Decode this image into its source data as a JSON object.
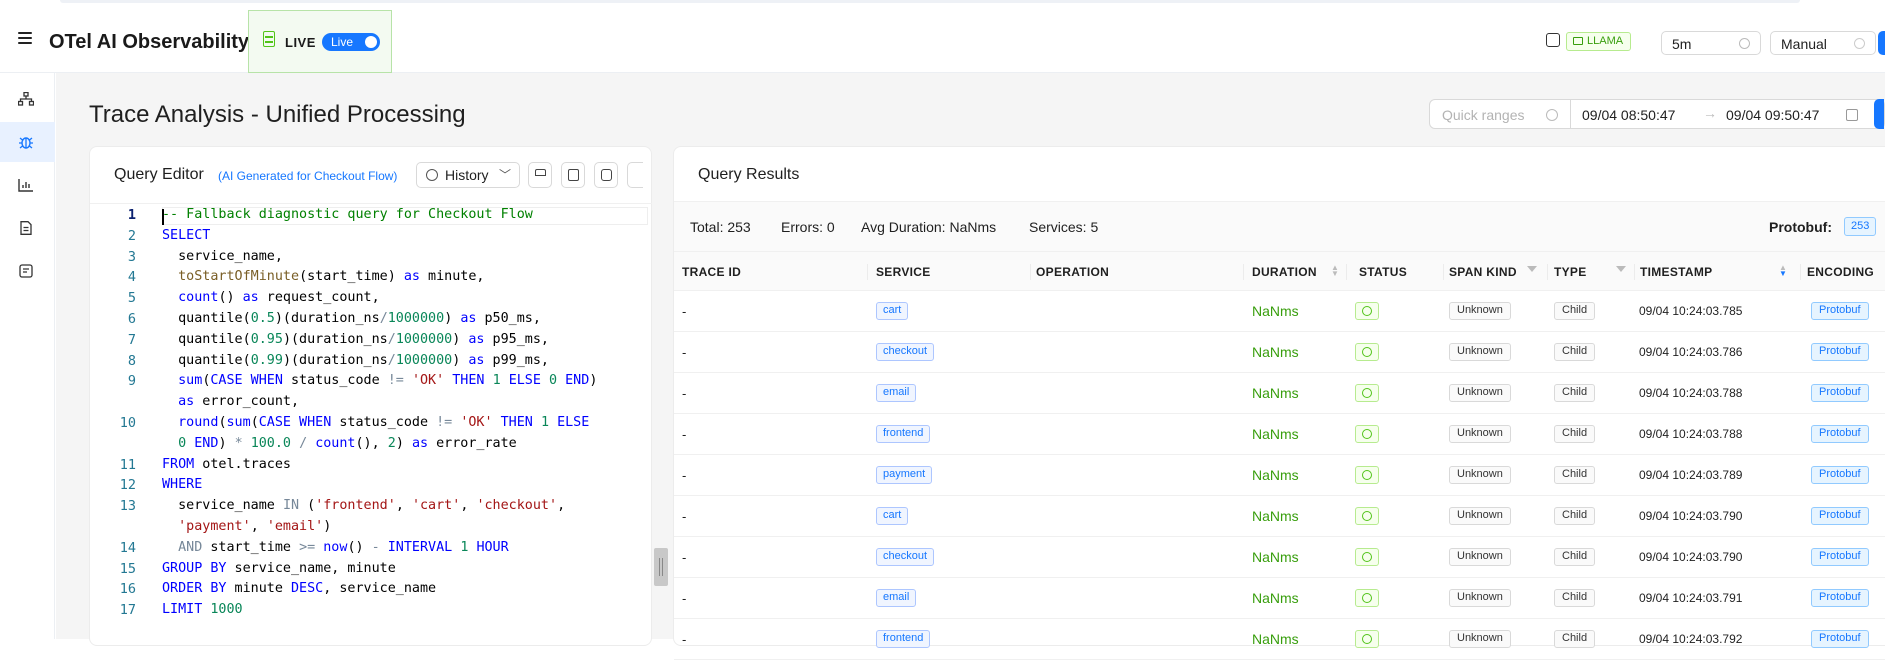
{
  "header": {
    "app_title": "OTel AI Observability",
    "live_label": "LIVE",
    "live_toggle": "Live",
    "llm_tag": "LLAMA",
    "interval": "5m",
    "refresh_mode": "Manual"
  },
  "sidebar": {
    "items": [
      {
        "icon": "topology-icon"
      },
      {
        "icon": "bug-icon",
        "active": true
      },
      {
        "icon": "bar-chart-icon"
      },
      {
        "icon": "document-icon"
      },
      {
        "icon": "llm-icon"
      }
    ]
  },
  "page": {
    "title": "Trace Analysis - Unified Processing",
    "quick_ranges_placeholder": "Quick ranges",
    "time_from": "09/04 08:50:47",
    "time_arrow": "→",
    "time_to": "09/04 09:50:47"
  },
  "editor": {
    "title": "Query Editor",
    "subtitle": "(AI Generated for Checkout Flow)",
    "history_label": "History",
    "line_numbers": [
      "1",
      "2",
      "3",
      "4",
      "5",
      "6",
      "7",
      "8",
      "9",
      "",
      "10",
      "",
      "11",
      "12",
      "13",
      "",
      "14",
      "15",
      "16",
      "17"
    ]
  },
  "results": {
    "title": "Query Results",
    "stats": {
      "total_label": "Total:",
      "total": "253",
      "errors_label": "Errors:",
      "errors": "0",
      "avg_label": "Avg Duration:",
      "avg": "NaNms",
      "services_label": "Services:",
      "services": "5",
      "protobuf_label": "Protobuf:",
      "protobuf_count": "253"
    },
    "columns": [
      "TRACE ID",
      "SERVICE",
      "OPERATION",
      "DURATION",
      "STATUS",
      "SPAN KIND",
      "TYPE",
      "TIMESTAMP",
      "ENCODING"
    ],
    "rows": [
      {
        "trace_id": "-",
        "service": "cart",
        "duration": "NaNms",
        "span_kind": "Unknown",
        "type": "Child",
        "timestamp": "09/04 10:24:03.785",
        "encoding": "Protobuf"
      },
      {
        "trace_id": "-",
        "service": "checkout",
        "duration": "NaNms",
        "span_kind": "Unknown",
        "type": "Child",
        "timestamp": "09/04 10:24:03.786",
        "encoding": "Protobuf"
      },
      {
        "trace_id": "-",
        "service": "email",
        "duration": "NaNms",
        "span_kind": "Unknown",
        "type": "Child",
        "timestamp": "09/04 10:24:03.788",
        "encoding": "Protobuf"
      },
      {
        "trace_id": "-",
        "service": "frontend",
        "duration": "NaNms",
        "span_kind": "Unknown",
        "type": "Child",
        "timestamp": "09/04 10:24:03.788",
        "encoding": "Protobuf"
      },
      {
        "trace_id": "-",
        "service": "payment",
        "duration": "NaNms",
        "span_kind": "Unknown",
        "type": "Child",
        "timestamp": "09/04 10:24:03.789",
        "encoding": "Protobuf"
      },
      {
        "trace_id": "-",
        "service": "cart",
        "duration": "NaNms",
        "span_kind": "Unknown",
        "type": "Child",
        "timestamp": "09/04 10:24:03.790",
        "encoding": "Protobuf"
      },
      {
        "trace_id": "-",
        "service": "checkout",
        "duration": "NaNms",
        "span_kind": "Unknown",
        "type": "Child",
        "timestamp": "09/04 10:24:03.790",
        "encoding": "Protobuf"
      },
      {
        "trace_id": "-",
        "service": "email",
        "duration": "NaNms",
        "span_kind": "Unknown",
        "type": "Child",
        "timestamp": "09/04 10:24:03.791",
        "encoding": "Protobuf"
      },
      {
        "trace_id": "-",
        "service": "frontend",
        "duration": "NaNms",
        "span_kind": "Unknown",
        "type": "Child",
        "timestamp": "09/04 10:24:03.792",
        "encoding": "Protobuf"
      }
    ]
  },
  "code": {
    "l1": "-- Fallback diagnostic query for Checkout Flow",
    "l2": "SELECT",
    "l3a": "  service_name,",
    "l4a": "  toStartOfMinute",
    "l4b": "(start_time) ",
    "l4c": "as",
    "l4d": " minute,",
    "l5a": "  count",
    "l5b": "() ",
    "l5c": "as",
    "l5d": " request_count,",
    "l6a": "  quantile(",
    "l6b": "0.5",
    "l6c": ")(duration_ns",
    "l6d": "/",
    "l6e": "1000000",
    "l6f": ") ",
    "l6g": "as",
    "l6h": " p50_ms,",
    "l7a": "  quantile(",
    "l7b": "0.95",
    "l7c": ")(duration_ns",
    "l7d": "/",
    "l7e": "1000000",
    "l7f": ") ",
    "l7g": "as",
    "l7h": " p95_ms,",
    "l8a": "  quantile(",
    "l8b": "0.99",
    "l8c": ")(duration_ns",
    "l8d": "/",
    "l8e": "1000000",
    "l8f": ") ",
    "l8g": "as",
    "l8h": " p99_ms,",
    "l9a": "  sum",
    "l9b": "(",
    "l9c": "CASE WHEN",
    "l9d": " status_code ",
    "l9e": "!=",
    "l9f": " ",
    "l9g": "'OK'",
    "l9h": " ",
    "l9i": "THEN",
    "l9j": " ",
    "l9k": "1",
    "l9l": " ",
    "l9m": "ELSE",
    "l9n": " ",
    "l9o": "0",
    "l9p": " ",
    "l9q": "END",
    "l9r": ")",
    "l9w1": "  ",
    "l9w2": "as",
    "l9w3": " error_count,",
    "l10a": "  round",
    "l10b": "(",
    "l10c": "sum",
    "l10d": "(",
    "l10e": "CASE WHEN",
    "l10f": " status_code ",
    "l10g": "!=",
    "l10h": " ",
    "l10i": "'OK'",
    "l10j": " ",
    "l10k": "THEN",
    "l10l": " ",
    "l10m": "1",
    "l10n": " ",
    "l10o": "ELSE",
    "l10w1": "  ",
    "l10w2": "0",
    "l10w3": " ",
    "l10w4": "END",
    "l10w5": ") ",
    "l10w6": "*",
    "l10w7": " ",
    "l10w8": "100.0",
    "l10w9": " ",
    "l10w10": "/",
    "l10w11": " ",
    "l10w12": "count",
    "l10w13": "(), ",
    "l10w14": "2",
    "l10w15": ") ",
    "l10w16": "as",
    "l10w17": " error_rate",
    "l11a": "FROM",
    "l11b": " otel.traces",
    "l12": "WHERE",
    "l13a": "  service_name ",
    "l13b": "IN",
    "l13c": " (",
    "l13d": "'frontend'",
    "l13e": ", ",
    "l13f": "'cart'",
    "l13g": ", ",
    "l13h": "'checkout'",
    "l13i": ",",
    "l13w1": "  ",
    "l13w2": "'payment'",
    "l13w3": ", ",
    "l13w4": "'email'",
    "l13w5": ")",
    "l14a": "  ",
    "l14b": "AND",
    "l14c": " start_time ",
    "l14d": ">=",
    "l14e": " ",
    "l14f": "now",
    "l14g": "() ",
    "l14h": "-",
    "l14i": " ",
    "l14j": "INTERVAL",
    "l14k": " ",
    "l14l": "1",
    "l14m": " ",
    "l14n": "HOUR",
    "l15a": "GROUP BY",
    "l15b": " service_name, minute",
    "l16a": "ORDER BY",
    "l16b": " minute ",
    "l16c": "DESC",
    "l16d": ", service_name",
    "l17a": "LIMIT",
    "l17b": " ",
    "l17c": "1000"
  }
}
